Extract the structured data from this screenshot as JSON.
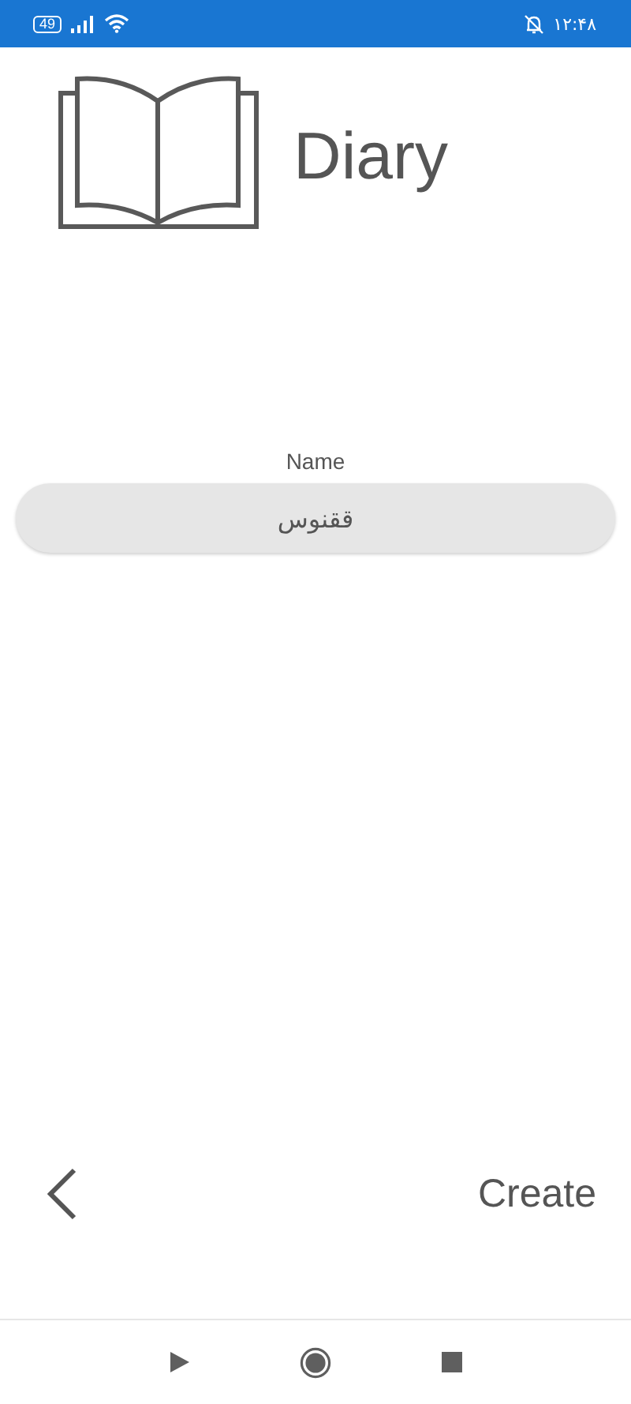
{
  "status_bar": {
    "battery": "49",
    "time": "۱۲:۴۸"
  },
  "header": {
    "title": "Diary"
  },
  "form": {
    "label": "Name",
    "value": "ققنوس"
  },
  "actions": {
    "create": "Create"
  }
}
